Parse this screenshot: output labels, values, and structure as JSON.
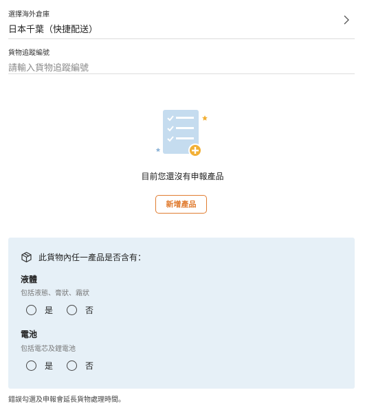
{
  "warehouse": {
    "label": "選擇海外倉庫",
    "value": "日本千葉（快捷配送）"
  },
  "tracking": {
    "label": "貨物追蹤編號",
    "placeholder": "請輸入貨物追蹤編號"
  },
  "empty": {
    "message": "目前您還沒有申報產品",
    "add_button": "新增產品"
  },
  "declaration": {
    "question": "此貨物內任一產品是否含有：",
    "groups": [
      {
        "title": "液體",
        "subtitle": "包括液態、膏狀、霜狀",
        "yes": "是",
        "no": "否"
      },
      {
        "title": "電池",
        "subtitle": "包括電芯及鋰電池",
        "yes": "是",
        "no": "否"
      }
    ]
  },
  "footnote": "錯誤勾選及申報會延長貨物處理時間。",
  "colors": {
    "accent": "#e07b2f",
    "panel": "#e6f0f7",
    "doc": "#c5dcef",
    "badge": "#f2b036"
  }
}
